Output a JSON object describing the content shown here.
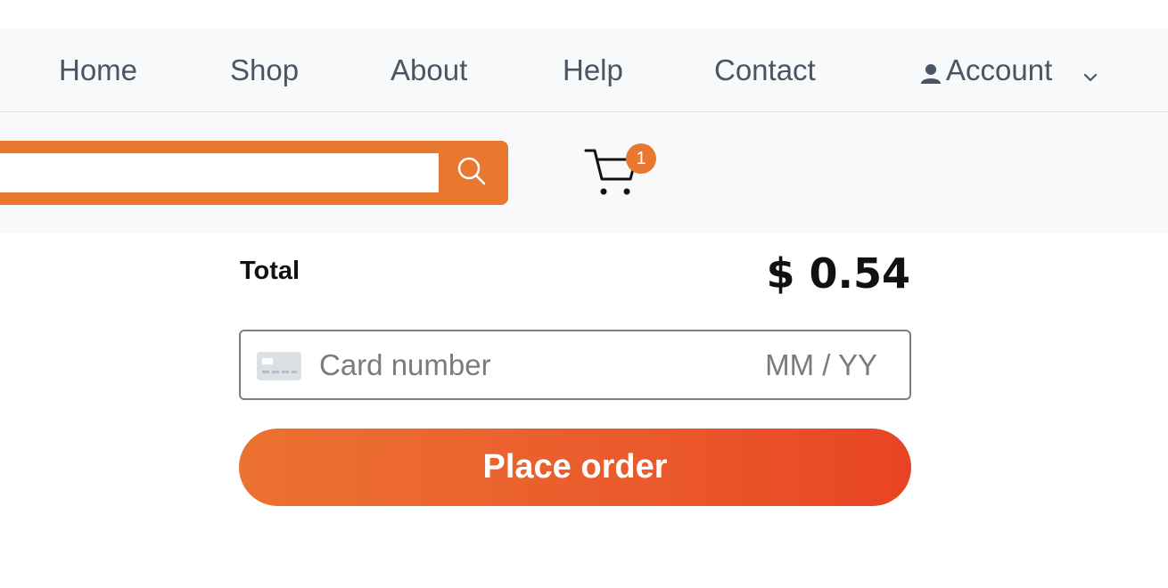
{
  "nav": {
    "items": [
      {
        "label": "Home"
      },
      {
        "label": "Shop"
      },
      {
        "label": "About"
      },
      {
        "label": "Help"
      },
      {
        "label": "Contact"
      }
    ],
    "account_label": "Account",
    "account_icon": "user-icon",
    "account_menu_icon": "chevron-down-icon"
  },
  "search": {
    "value": "",
    "placeholder": "",
    "button_icon": "search-icon"
  },
  "cart": {
    "icon": "cart-icon",
    "badge_count": "1"
  },
  "checkout": {
    "total_label": "Total",
    "total_value": "$ 0.54",
    "card_icon": "credit-card-icon",
    "card_number_placeholder": "Card number",
    "expiry_placeholder": "MM / YY",
    "place_order_label": "Place order"
  },
  "colors": {
    "accent": "#e8782f",
    "button_gradient_start": "#ec7230",
    "button_gradient_end": "#e84424",
    "nav_text": "#4a5563",
    "bar_background": "#f8f9fb"
  }
}
